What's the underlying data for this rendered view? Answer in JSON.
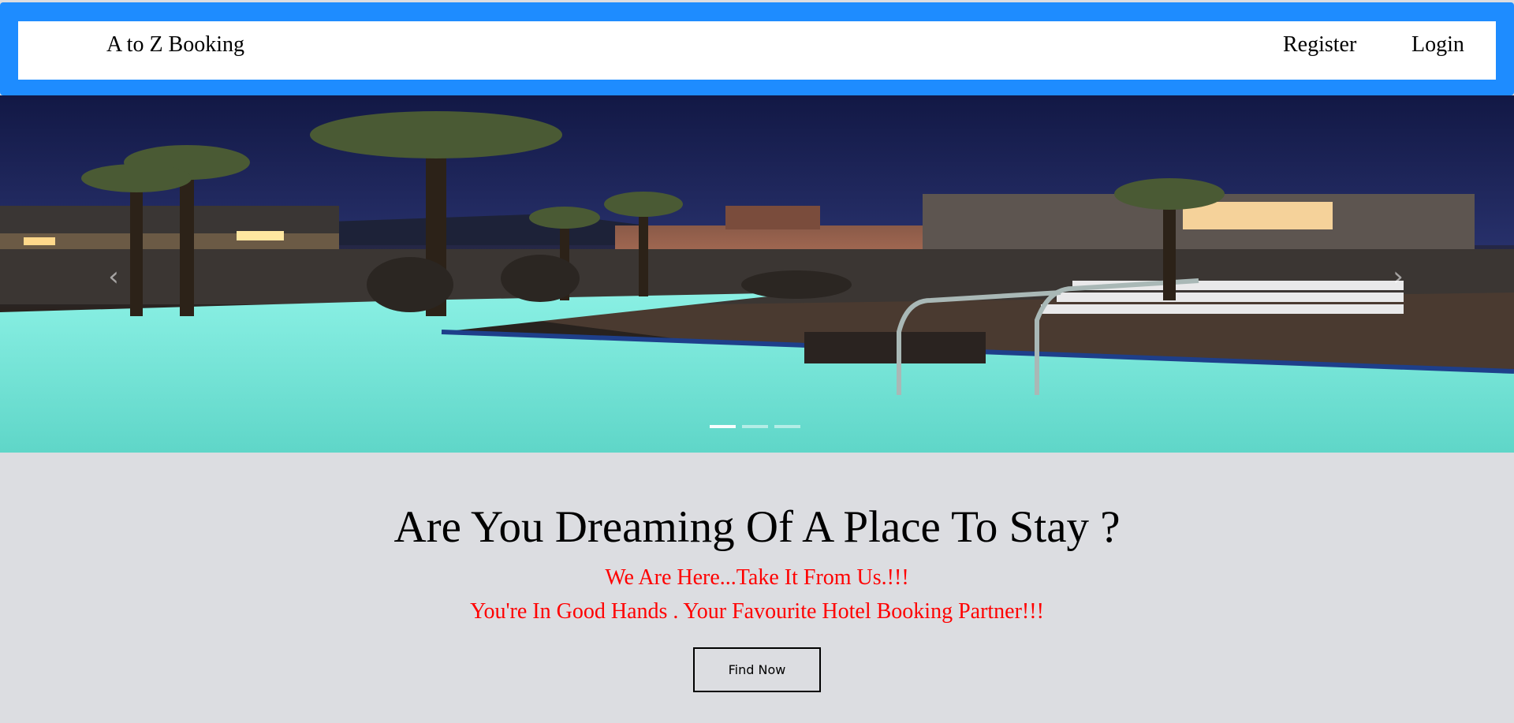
{
  "navbar": {
    "brand": "A to Z Booking",
    "links": [
      {
        "label": "Register"
      },
      {
        "label": "Login"
      }
    ]
  },
  "carousel": {
    "prev_icon": "chevron-left-icon",
    "next_icon": "chevron-right-icon",
    "slides_count": 3,
    "active_slide": 1
  },
  "hero": {
    "headline": "Are You Dreaming Of A Place To Stay ?",
    "tagline_1": "We Are Here...Take It From Us.!!!",
    "tagline_2": "You're In Good Hands . Your Favourite Hotel Booking Partner!!!",
    "cta_label": "Find Now"
  },
  "colors": {
    "navbar_frame": "#1e8cff",
    "tagline": "#ff0000",
    "background": "#dcdde1"
  }
}
